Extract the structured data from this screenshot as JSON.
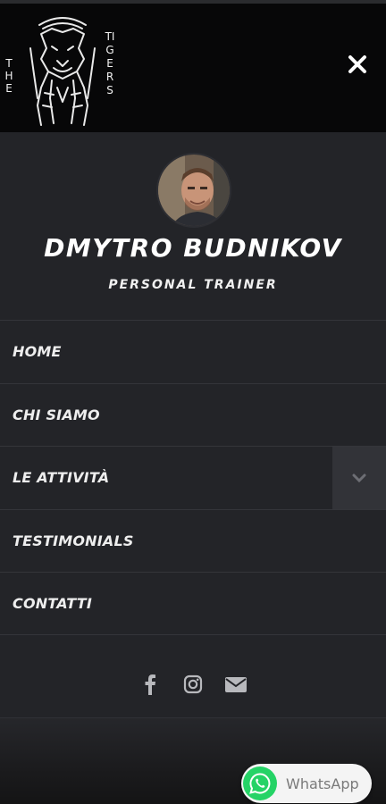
{
  "brand": {
    "logo_left": "THE",
    "logo_right": "TIGERS"
  },
  "profile": {
    "name": "DMYTRO BUDNIKOV",
    "role": "PERSONAL TRAINER"
  },
  "menu": {
    "items": [
      {
        "label": "HOME"
      },
      {
        "label": "CHI SIAMO"
      },
      {
        "label": "LE ATTIVITÀ"
      },
      {
        "label": "TESTIMONIALS"
      },
      {
        "label": "CONTATTI"
      }
    ]
  },
  "social": {
    "icons": [
      "facebook-icon",
      "instagram-icon",
      "email-icon"
    ]
  },
  "whatsapp": {
    "label": "WhatsApp",
    "color": "#25d366"
  },
  "colors": {
    "header_bg": "#070708",
    "drawer_bg": "#232428",
    "text": "#ffffff"
  }
}
